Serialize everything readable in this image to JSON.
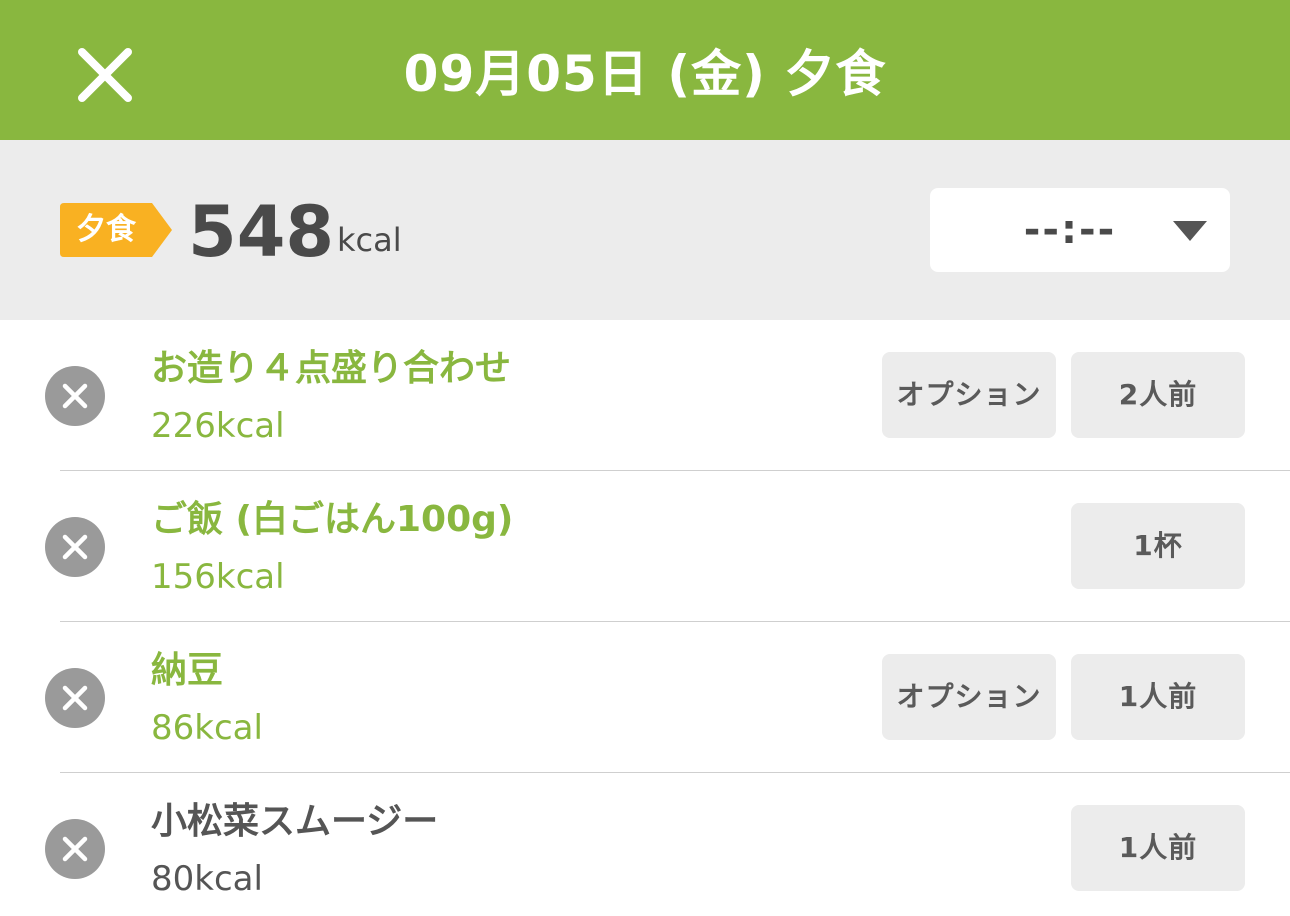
{
  "header": {
    "title": "09月05日 (金) 夕食",
    "close_icon": "close-icon",
    "background": "#89b73f"
  },
  "summary": {
    "meal_badge": "夕食",
    "badge_color": "#f9b122",
    "total_kcal": "548",
    "unit": "kcal",
    "time_value": "--:--",
    "time_icon": "caret-down-icon"
  },
  "foods": [
    {
      "name": "お造り４点盛り合わせ",
      "kcal": "226kcal",
      "option_label": "オプション",
      "amount_label": "2人前",
      "name_color": "green"
    },
    {
      "name": "ご飯 (白ごはん100g)",
      "kcal": "156kcal",
      "option_label": "",
      "amount_label": "1杯",
      "name_color": "green"
    },
    {
      "name": "納豆",
      "kcal": "86kcal",
      "option_label": "オプション",
      "amount_label": "1人前",
      "name_color": "green"
    },
    {
      "name": "小松菜スムージー",
      "kcal": "80kcal",
      "option_label": "",
      "amount_label": "1人前",
      "name_color": "gray"
    }
  ]
}
